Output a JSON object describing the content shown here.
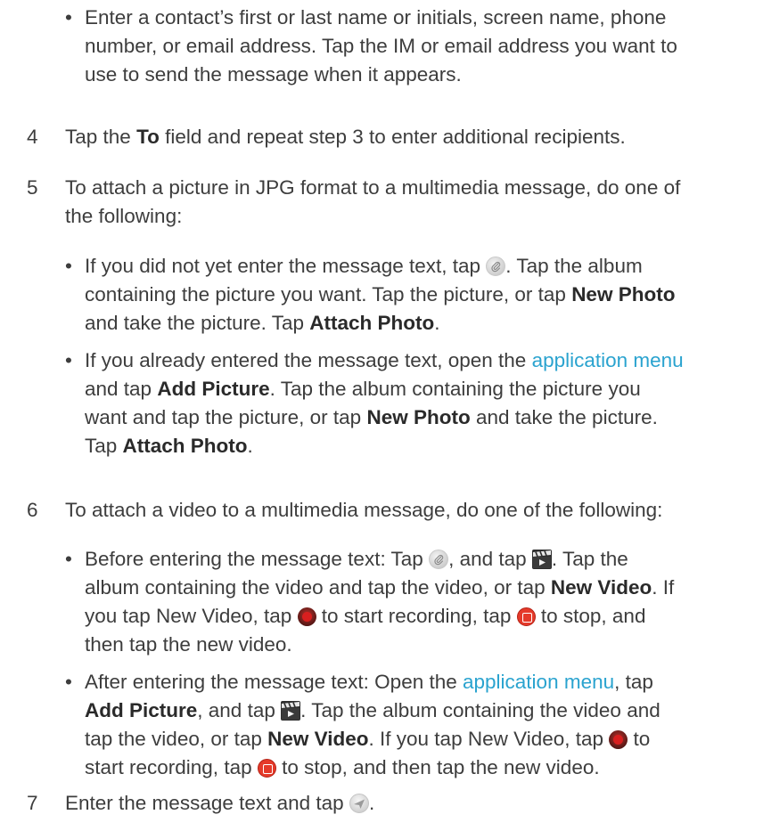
{
  "bullet_char": "•",
  "intro_bullet": {
    "line1": "Enter a contact’s first or last name or initials, screen name, phone",
    "line2": "number, or email address. Tap the IM or email address you want to",
    "line3": "use to send the message when it appears."
  },
  "step4": {
    "number": "4",
    "pre": "Tap the ",
    "bold": "To",
    "post": " field and repeat step 3 to enter additional recipients."
  },
  "step5": {
    "number": "5",
    "line1": "To attach a picture in JPG format to a multimedia message, do one of",
    "line2": "the following:",
    "b1": {
      "t1": "If you did not yet enter the message text, tap ",
      "t2": ". Tap the album",
      "t3": "containing the picture you want. Tap the picture, or tap ",
      "bold1": "New Photo",
      "t4": "and take the picture. Tap ",
      "bold2": "Attach Photo",
      "t5": "."
    },
    "b2": {
      "t1": "If you already entered the message text, open the ",
      "link": "application menu",
      "t2": "and tap ",
      "bold1": "Add Picture",
      "t3": ". Tap the album containing the picture you",
      "t4": "want and tap the picture, or tap ",
      "bold2": "New Photo",
      "t5": " and take the picture.",
      "t6": "Tap ",
      "bold3": "Attach Photo",
      "t7": "."
    }
  },
  "step6": {
    "number": "6",
    "line1": "To attach a video to a multimedia message, do one of the following:",
    "b1": {
      "t1": "Before entering the message text: Tap ",
      "t2": ", and tap ",
      "t3": ". Tap the",
      "t4": "album containing the video and tap the video, or tap ",
      "bold1": "New Video",
      "t5": ". If",
      "t6": "you tap New Video, tap ",
      "t7": " to start recording, tap ",
      "t8": " to stop, and",
      "t9": "then tap the new video."
    },
    "b2": {
      "t1": "After entering the message text: Open the ",
      "link": "application menu",
      "t2": ", tap",
      "bold1": "Add Picture",
      "t3": ", and tap ",
      "t4": ". Tap the album containing the video and",
      "t5": "tap the video, or tap ",
      "bold2": "New Video",
      "t6": ". If you tap New Video, tap ",
      "t7": " to",
      "t8": "start recording, tap ",
      "t9": " to stop, and then tap the new video."
    }
  },
  "step7": {
    "number": "7",
    "t1": "Enter the message text and tap ",
    "t2": "."
  },
  "colors": {
    "text": "#3d3d3d",
    "link": "#2aa3cf",
    "record": "#d81f1f",
    "stop": "#e53a2a"
  },
  "icons": [
    "attach-icon",
    "video-icon",
    "record-icon",
    "stop-icon",
    "send-icon"
  ]
}
